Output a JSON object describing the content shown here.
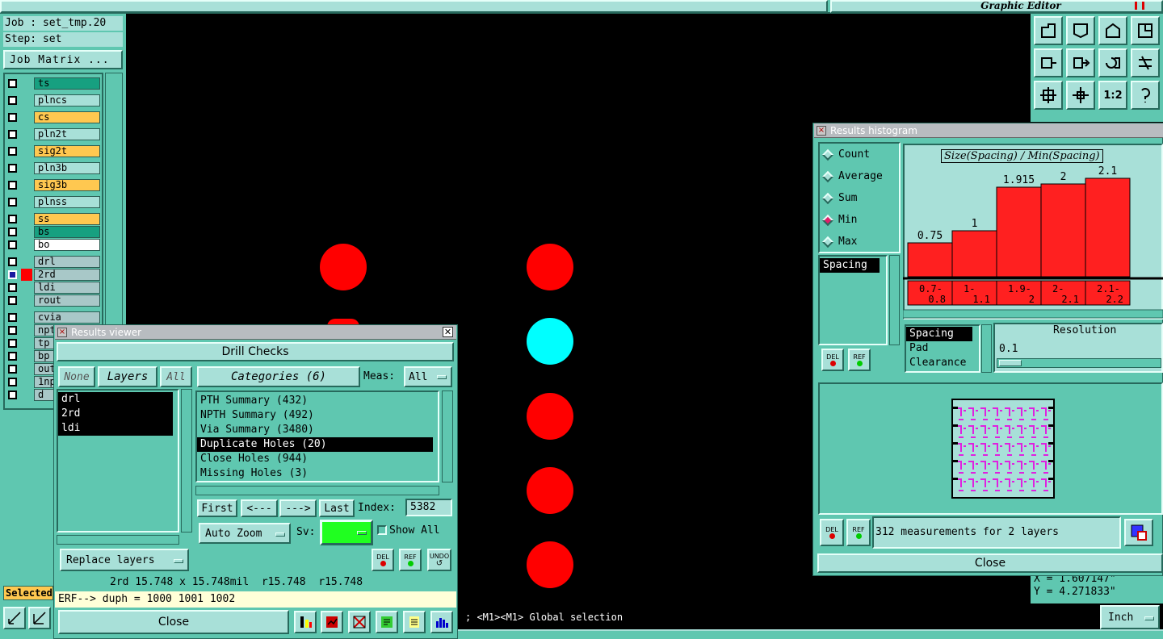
{
  "title_bar": {
    "title": "Graphic Editor"
  },
  "job": {
    "job_label": "Job : set_tmp.20",
    "step_label": "Step: set",
    "matrix_button": "Job Matrix ..."
  },
  "layers": [
    {
      "name": "ts",
      "color": "#17a080"
    },
    {
      "name": "plncs",
      "color": "#a8e0d8"
    },
    {
      "name": "cs",
      "color": "#ffc850"
    },
    {
      "name": "pln2t",
      "color": "#a8e0d8"
    },
    {
      "name": "sig2t",
      "color": "#ffc850"
    },
    {
      "name": "pln3b",
      "color": "#a8e0d8"
    },
    {
      "name": "sig3b",
      "color": "#ffc850"
    },
    {
      "name": "plnss",
      "color": "#a8e0d8"
    },
    {
      "name": "ss",
      "color": "#ffc850"
    },
    {
      "name": "bs",
      "color": "#17a080"
    },
    {
      "name": "bo",
      "color": "#ffffff"
    },
    {
      "name": "drl",
      "color": "#a8c8c8"
    },
    {
      "name": "2rd",
      "color": "#a8c8c8"
    },
    {
      "name": "ldi",
      "color": "#a8c8c8"
    },
    {
      "name": "rout",
      "color": "#a8c8c8"
    },
    {
      "name": "cvia",
      "color": "#a8c8c8"
    },
    {
      "name": "npth",
      "color": "#a8c8c8"
    },
    {
      "name": "tp",
      "color": "#a8c8c8"
    },
    {
      "name": "bp",
      "color": "#a8c8c8"
    },
    {
      "name": "out",
      "color": "#a8c8c8"
    },
    {
      "name": "1np",
      "color": "#a8c8c8"
    },
    {
      "name": "d",
      "color": "#a8c8c8"
    }
  ],
  "selected_label": "Selected",
  "results_viewer": {
    "title": "Results viewer",
    "header": "Drill Checks",
    "none_btn": "None",
    "layers_btn": "Layers",
    "all_btn": "All",
    "layer_list": [
      "drl",
      "2rd",
      "ldi"
    ],
    "categories_btn": "Categories (6)",
    "meas_label": "Meas:",
    "meas_value": "All",
    "categories": [
      "PTH Summary (432)",
      "NPTH Summary (492)",
      "Via Summary (3480)",
      "Duplicate Holes (20)",
      "Close Holes (944)",
      "Missing Holes (3)"
    ],
    "selected_category": 3,
    "first_btn": "First",
    "prev_btn": "<---",
    "next_btn": "--->",
    "last_btn": "Last",
    "index_label": "Index:",
    "index_value": "5382",
    "auto_zoom": "Auto Zoom",
    "sv_label": "Sv:",
    "show_all": "Show All",
    "replace_layers": "Replace layers",
    "del_label": "DEL",
    "ref_label": "REF",
    "undo_label": "UNDO",
    "info_line": "2rd 15.748 x 15.748mil  r15.748  r15.748",
    "erf_line": "ERF--> duph = 1000 1001 1002",
    "close": "Close"
  },
  "histogram": {
    "title": "Results histogram",
    "modes": [
      "Count",
      "Average",
      "Sum",
      "Min",
      "Max"
    ],
    "selected_mode": "Min",
    "measure_list": [
      "Spacing"
    ],
    "chart_title": "Size(Spacing) / Min(Spacing)",
    "bins": [
      "0.7-\n0.8",
      "1-\n1.1",
      "1.9-\n2",
      "2-\n2.1",
      "2.1-\n2.2"
    ],
    "bin_labels": [
      "0.7-",
      "1-",
      "1.9-",
      "2-",
      "2.1-"
    ],
    "bin_labels2": [
      "0.8",
      "1.1",
      "2",
      "2.1",
      "2.2"
    ],
    "values": [
      0.75,
      1,
      1.915,
      2,
      2.1
    ],
    "value_labels": [
      "0.75",
      "1",
      "1.915",
      "2",
      "2.1"
    ],
    "bar_color": "#ff2020",
    "type_list": [
      "Spacing",
      "Pad",
      "Clearance"
    ],
    "resolution_label": "Resolution",
    "resolution_value": "0.1",
    "measurements": "312 measurements for 2 layers",
    "del_label": "DEL",
    "ref_label": "REF",
    "close": "Close"
  },
  "status": {
    "message": "; <M1><M1> Global selection",
    "units": "Inch",
    "x_coord": "X = 1.607147\"",
    "y_coord": "Y = 4.271833\""
  },
  "canvas_pads": {
    "red": "#ff0000",
    "cyan": "#00ffff"
  }
}
